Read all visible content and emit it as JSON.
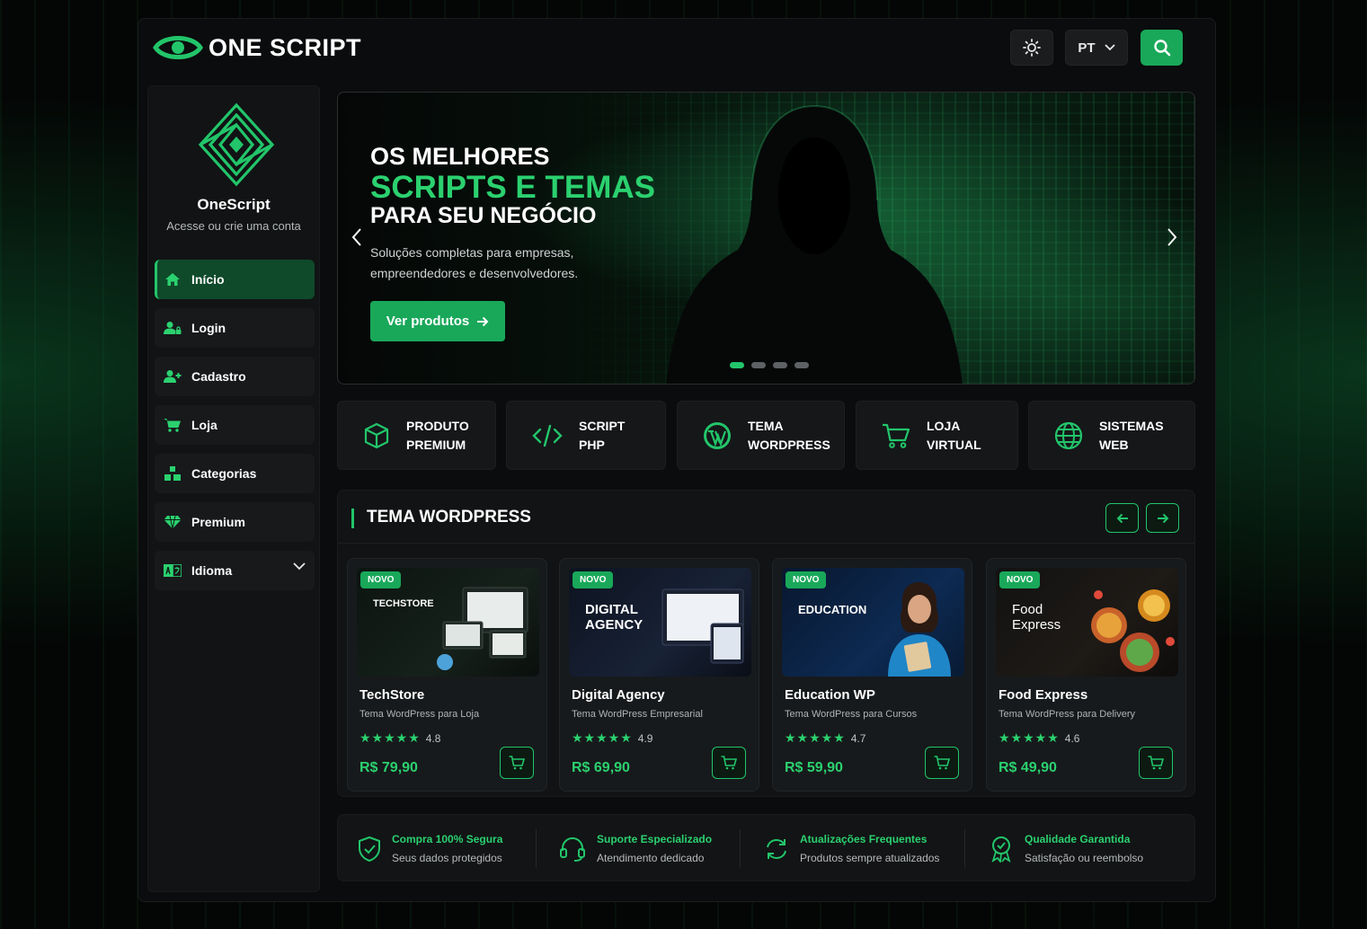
{
  "header": {
    "logo_text": "ONE SCRIPT",
    "language": "PT",
    "icons": [
      "sun-icon",
      "chevron-down-icon",
      "search-icon"
    ]
  },
  "sidebar": {
    "brand_name": "OneScript",
    "brand_sub": "Acesse ou crie uma conta",
    "items": [
      {
        "label": "Início",
        "icon": "home-icon",
        "active": true
      },
      {
        "label": "Login",
        "icon": "user-lock-icon"
      },
      {
        "label": "Cadastro",
        "icon": "user-plus-icon"
      },
      {
        "label": "Loja",
        "icon": "cart-icon"
      },
      {
        "label": "Categorias",
        "icon": "blocks-icon"
      },
      {
        "label": "Premium",
        "icon": "diamond-icon"
      },
      {
        "label": "Idioma",
        "icon": "language-icon"
      }
    ]
  },
  "hero": {
    "line1": "OS MELHORES",
    "line2": "SCRIPTS E TEMAS",
    "line3": "PARA SEU NEGÓCIO",
    "description": "Soluções completas para empresas, empreendedores e desenvolvedores.",
    "cta": "Ver produtos",
    "slide_count": 4,
    "active_slide": 1
  },
  "categories": [
    {
      "label": "PRODUTO\nPREMIUM",
      "icon": "box-icon"
    },
    {
      "label": "SCRIPT\nPHP",
      "icon": "code-icon"
    },
    {
      "label": "TEMA\nWORDPRESS",
      "icon": "wordpress-icon"
    },
    {
      "label": "LOJA\nVIRTUAL",
      "icon": "cart-icon"
    },
    {
      "label": "SISTEMAS\nWEB",
      "icon": "globe-icon"
    }
  ],
  "section": {
    "title": "TEMA WORDPRESS",
    "products": [
      {
        "badge": "NOVO",
        "thumb_title": "TECHSTORE",
        "name": "TechStore",
        "subtitle": "Tema WordPress para Loja",
        "rating": "4.8",
        "price": "R$ 79,90"
      },
      {
        "badge": "NOVO",
        "thumb_title": "DIGITAL\nAGENCY",
        "name": "Digital Agency",
        "subtitle": "Tema WordPress Empresarial",
        "rating": "4.9",
        "price": "R$ 69,90"
      },
      {
        "badge": "NOVO",
        "thumb_title": "EDUCATION",
        "name": "Education WP",
        "subtitle": "Tema WordPress para Cursos",
        "rating": "4.7",
        "price": "R$ 59,90"
      },
      {
        "badge": "NOVO",
        "thumb_title": "Food\nExpress",
        "name": "Food Express",
        "subtitle": "Tema WordPress para Delivery",
        "rating": "4.6",
        "price": "R$ 49,90"
      }
    ]
  },
  "features": [
    {
      "title": "Compra 100% Segura",
      "subtitle": "Seus dados protegidos",
      "icon": "shield-check-icon"
    },
    {
      "title": "Suporte Especializado",
      "subtitle": "Atendimento dedicado",
      "icon": "headset-icon"
    },
    {
      "title": "Atualizações Frequentes",
      "subtitle": "Produtos sempre atualizados",
      "icon": "refresh-icon"
    },
    {
      "title": "Qualidade Garantida",
      "subtitle": "Satisfação ou reembolso",
      "icon": "award-icon"
    }
  ],
  "colors": {
    "accent": "#22c56a",
    "accent_dark": "#19a85a",
    "background": "#0b0c0d"
  }
}
